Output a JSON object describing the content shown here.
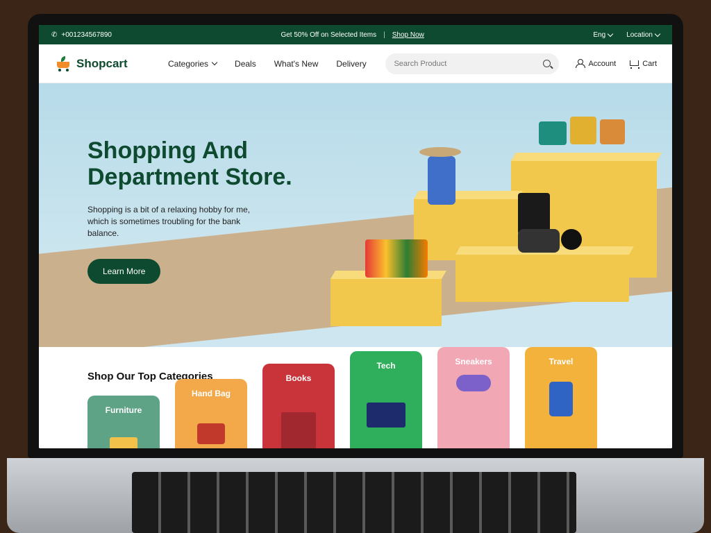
{
  "topbar": {
    "phone": "+001234567890",
    "promo": "Get 50% Off on Selected Items",
    "promo_sep": "|",
    "promo_link": "Shop Now",
    "language": "Eng",
    "location": "Location"
  },
  "header": {
    "brand": "Shopcart",
    "nav": [
      "Categories",
      "Deals",
      "What's New",
      "Delivery"
    ],
    "search_placeholder": "Search Product",
    "account_label": "Account",
    "cart_label": "Cart"
  },
  "hero": {
    "title_line1": "Shopping And",
    "title_line2": "Department Store.",
    "subtitle": "Shopping is a bit of a relaxing hobby for me, which is sometimes troubling for the bank balance.",
    "cta": "Learn More"
  },
  "categories": {
    "heading": "Shop Our Top Categories",
    "items": [
      {
        "label": "Furniture",
        "color": "#5fa386"
      },
      {
        "label": "Hand Bag",
        "color": "#f3a94a"
      },
      {
        "label": "Books",
        "color": "#c9343b"
      },
      {
        "label": "Tech",
        "color": "#2fae5c"
      },
      {
        "label": "Sneakers",
        "color": "#f2a7b4"
      },
      {
        "label": "Travel",
        "color": "#f3b23b"
      }
    ]
  },
  "colors": {
    "brand_green": "#0d4a2f",
    "pedestal_yellow": "#f1c84c",
    "sky": "#b7dbe9"
  }
}
